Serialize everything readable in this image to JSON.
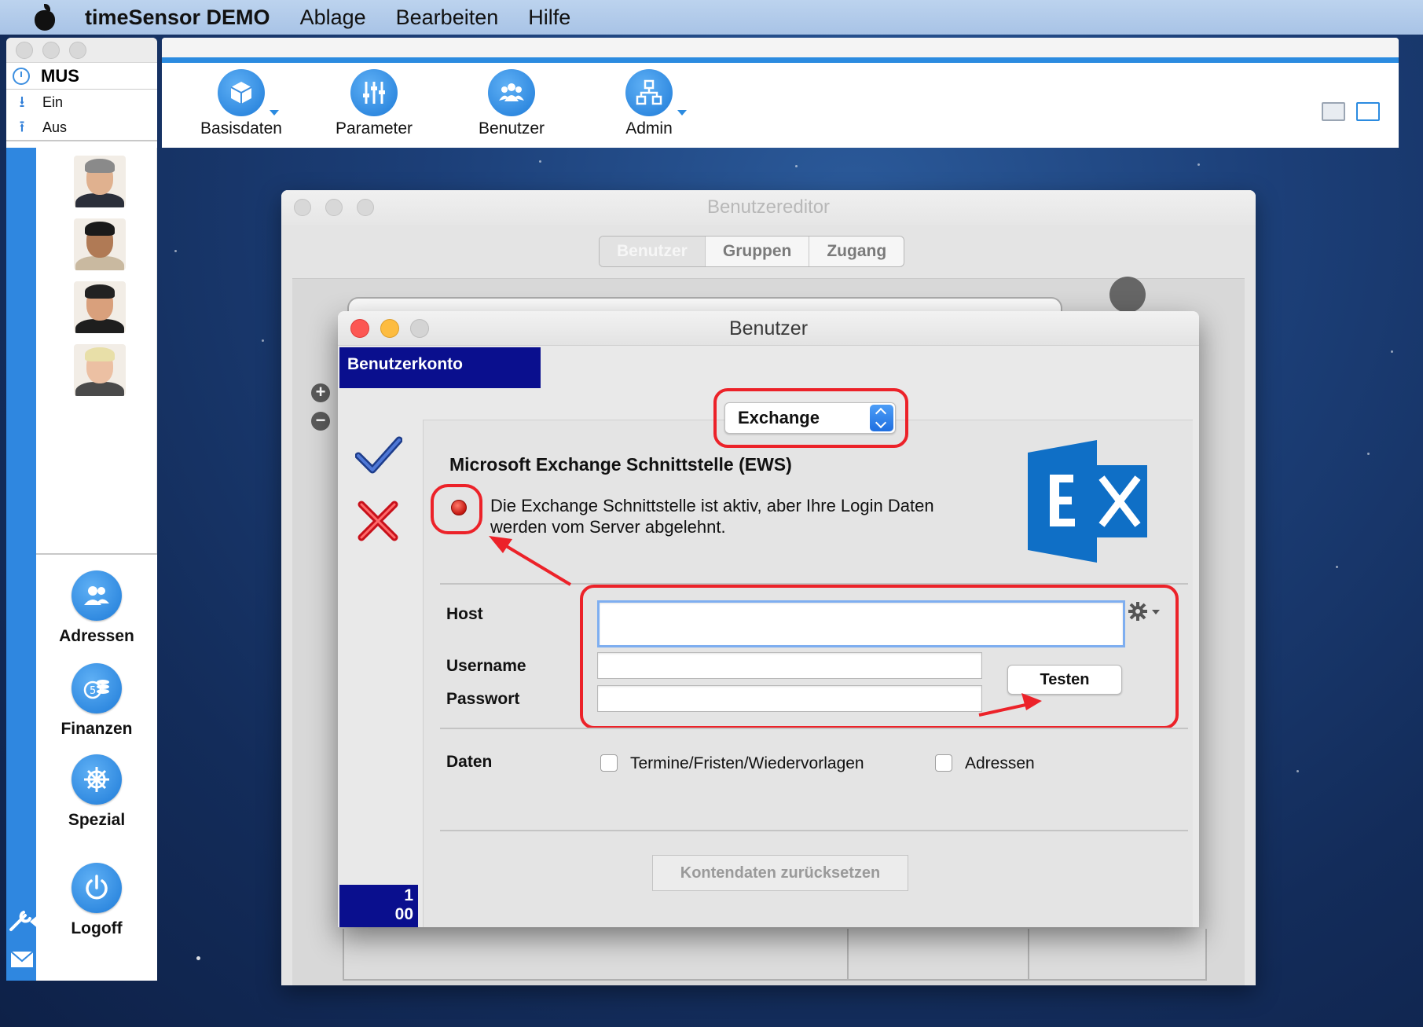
{
  "menubar": {
    "app_name": "timeSensor DEMO",
    "items": [
      "Ablage",
      "Bearbeiten",
      "Hilfe"
    ]
  },
  "sidebar": {
    "user_code": "MUS",
    "clock_in": "Ein",
    "clock_out": "Aus",
    "nav": [
      {
        "label": "Adressen",
        "icon": "people-icon"
      },
      {
        "label": "Finanzen",
        "icon": "coins-icon"
      },
      {
        "label": "Spezial",
        "icon": "helm-icon"
      },
      {
        "label": "Logoff",
        "icon": "power-icon"
      }
    ]
  },
  "toolbar": {
    "buttons": [
      {
        "label": "Basisdaten",
        "icon": "cube-icon"
      },
      {
        "label": "Parameter",
        "icon": "sliders-icon"
      },
      {
        "label": "Benutzer",
        "icon": "users-icon"
      },
      {
        "label": "Admin",
        "icon": "hierarchy-icon"
      }
    ]
  },
  "editor": {
    "title": "Benutzereditor",
    "tabs": [
      "Benutzer",
      "Gruppen",
      "Zugang"
    ],
    "active_tab": "Benutzer"
  },
  "dialog": {
    "title": "Benutzer",
    "section_label": "Benutzerkonto",
    "pager": "1\n00",
    "pager_top": "1",
    "pager_bottom": "00",
    "selector_value": "Exchange",
    "heading": "Microsoft Exchange Schnittstelle (EWS)",
    "status_text": "Die Exchange Schnittstelle ist aktiv, aber Ihre Login Daten werden vom Server abgelehnt.",
    "status_color": "#c4160f",
    "fields": {
      "host_label": "Host",
      "host_value": "",
      "username_label": "Username",
      "username_value": "",
      "password_label": "Passwort",
      "password_value": ""
    },
    "test_button": "Testen",
    "data_label": "Daten",
    "checkboxes": [
      {
        "label": "Termine/Fristen/Wiedervorlagen",
        "checked": false
      },
      {
        "label": "Adressen",
        "checked": false
      }
    ],
    "reset_button": "Kontendaten zurücksetzen"
  },
  "colors": {
    "accent_blue": "#2b8be0",
    "highlight_red": "#ec2229",
    "konto_blue": "#0a0f8e",
    "exchange_blue": "#0f6fc6"
  }
}
